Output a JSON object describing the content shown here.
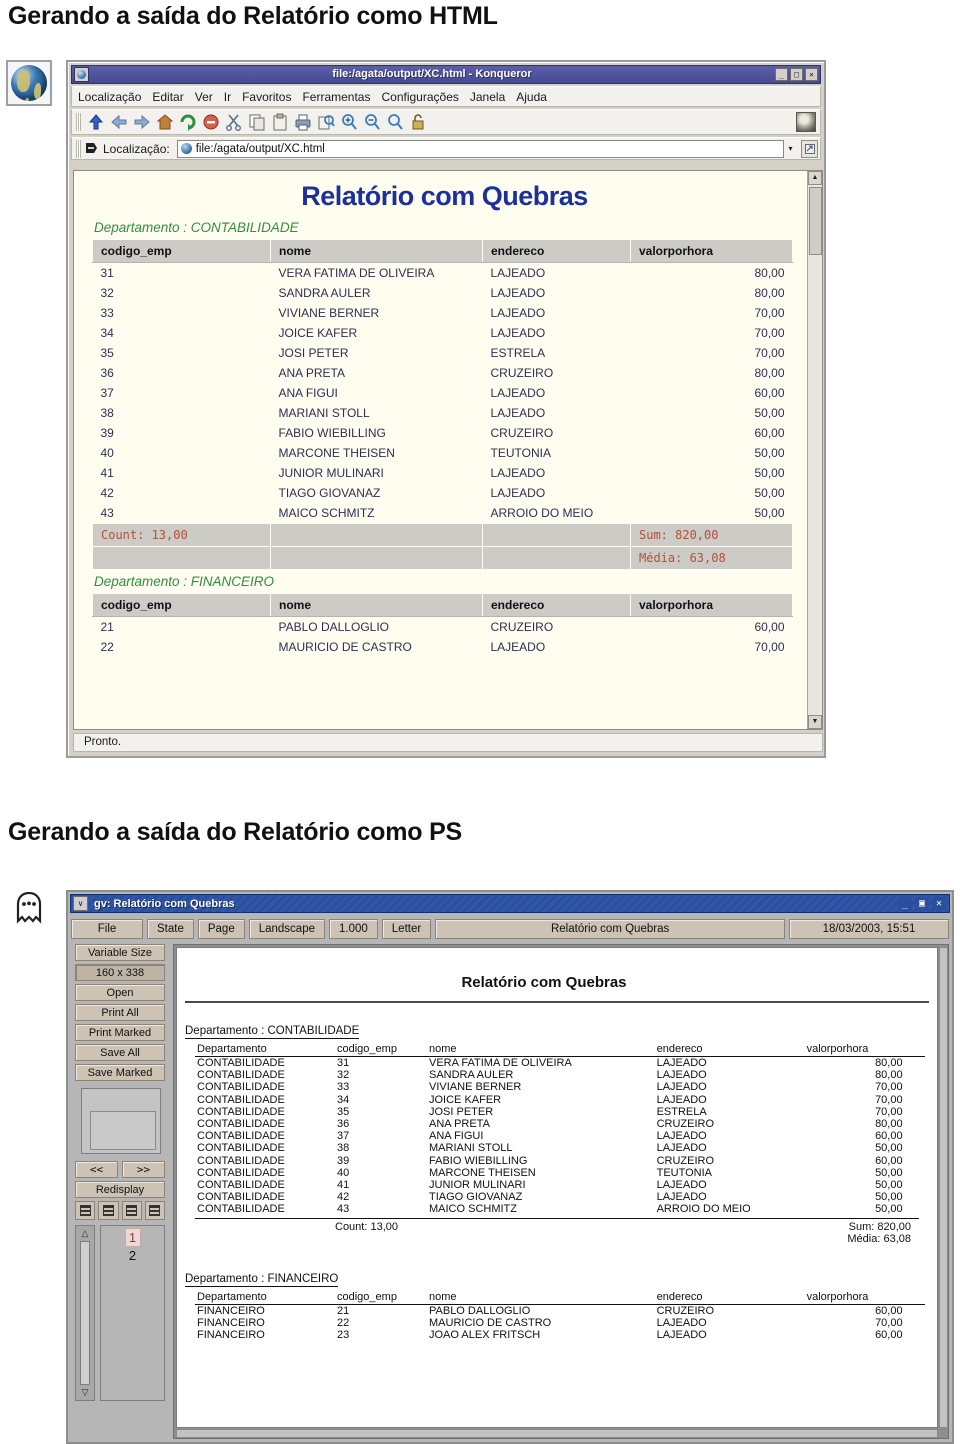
{
  "slides": {
    "html_heading": "Gerando a saída do Relatório como HTML",
    "ps_heading": "Gerando a saída do Relatório como PS"
  },
  "icons": {
    "globe": "globe-icon",
    "ghost": "ghost-icon"
  },
  "konqueror": {
    "title": "file:/agata/output/XC.html - Konqueror",
    "window_buttons": {
      "minimize": "_",
      "maximize": "□",
      "close": "✕"
    },
    "menu": [
      {
        "label": "Localização"
      },
      {
        "label": "Editar"
      },
      {
        "label": "Ver"
      },
      {
        "label": "Ir"
      },
      {
        "label": "Favoritos"
      },
      {
        "label": "Ferramentas"
      },
      {
        "label": "Configurações"
      },
      {
        "label": "Janela"
      },
      {
        "label": "Ajuda"
      }
    ],
    "toolbar_icons": [
      "up-arrow-icon",
      "back-arrow-icon",
      "forward-arrow-icon",
      "home-icon",
      "reload-icon",
      "stop-icon",
      "cut-scissors-icon",
      "copy-icon",
      "paste-icon",
      "print-icon",
      "find-icon",
      "zoom-in-icon",
      "zoom-out-icon",
      "zoom-reset-icon",
      "lock-icon"
    ],
    "location": {
      "label": "Localização:",
      "value": "file:/agata/output/XC.html",
      "placeholder": "file:/"
    },
    "statusbar": "Pronto."
  },
  "report": {
    "title": "Relatório com Quebras",
    "columns": [
      "codigo_emp",
      "nome",
      "endereco",
      "valorporhora"
    ],
    "groups": [
      {
        "label": "Departamento : CONTABILIDADE",
        "dept": "CONTABILIDADE",
        "rows": [
          {
            "codigo_emp": "31",
            "nome": "VERA FATIMA DE OLIVEIRA",
            "endereco": "LAJEADO",
            "valorporhora": "80,00"
          },
          {
            "codigo_emp": "32",
            "nome": "SANDRA AULER",
            "endereco": "LAJEADO",
            "valorporhora": "80,00"
          },
          {
            "codigo_emp": "33",
            "nome": "VIVIANE BERNER",
            "endereco": "LAJEADO",
            "valorporhora": "70,00"
          },
          {
            "codigo_emp": "34",
            "nome": "JOICE KAFER",
            "endereco": "LAJEADO",
            "valorporhora": "70,00"
          },
          {
            "codigo_emp": "35",
            "nome": "JOSI PETER",
            "endereco": "ESTRELA",
            "valorporhora": "70,00"
          },
          {
            "codigo_emp": "36",
            "nome": "ANA PRETA",
            "endereco": "CRUZEIRO",
            "valorporhora": "80,00"
          },
          {
            "codigo_emp": "37",
            "nome": "ANA FIGUI",
            "endereco": "LAJEADO",
            "valorporhora": "60,00"
          },
          {
            "codigo_emp": "38",
            "nome": "MARIANI STOLL",
            "endereco": "LAJEADO",
            "valorporhora": "50,00"
          },
          {
            "codigo_emp": "39",
            "nome": "FABIO WIEBILLING",
            "endereco": "CRUZEIRO",
            "valorporhora": "60,00"
          },
          {
            "codigo_emp": "40",
            "nome": "MARCONE THEISEN",
            "endereco": "TEUTONIA",
            "valorporhora": "50,00"
          },
          {
            "codigo_emp": "41",
            "nome": "JUNIOR MULINARI",
            "endereco": "LAJEADO",
            "valorporhora": "50,00"
          },
          {
            "codigo_emp": "42",
            "nome": "TIAGO GIOVANAZ",
            "endereco": "LAJEADO",
            "valorporhora": "50,00"
          },
          {
            "codigo_emp": "43",
            "nome": "MAICO SCHMITZ",
            "endereco": "ARROIO DO MEIO",
            "valorporhora": "50,00"
          }
        ],
        "summary": {
          "count": "Count: 13,00",
          "sum": "Sum: 820,00",
          "media": "Média: 63,08"
        }
      },
      {
        "label": "Departamento : FINANCEIRO",
        "dept": "FINANCEIRO",
        "rows": [
          {
            "codigo_emp": "21",
            "nome": "PABLO DALLOGLIO",
            "endereco": "CRUZEIRO",
            "valorporhora": "60,00"
          },
          {
            "codigo_emp": "22",
            "nome": "MAURICIO DE CASTRO",
            "endereco": "LAJEADO",
            "valorporhora": "70,00"
          },
          {
            "codigo_emp": "23",
            "nome": "JOAO ALEX FRITSCH",
            "endereco": "LAJEADO",
            "valorporhora": "60,00"
          }
        ]
      }
    ]
  },
  "gv": {
    "title": "gv: Relatório com Quebras",
    "window_buttons": {
      "minimize": "_",
      "maximize": "▣",
      "close": "✕"
    },
    "menu_button": "∨",
    "toolbar": [
      {
        "label": "File",
        "name": "file-menu"
      },
      {
        "label": "State",
        "name": "state-menu"
      },
      {
        "label": "Page",
        "name": "page-menu"
      },
      {
        "label": "Landscape",
        "name": "orientation-menu"
      },
      {
        "label": "1.000",
        "name": "scale-menu"
      },
      {
        "label": "Letter",
        "name": "papersize-menu"
      }
    ],
    "document_label": "Relatório com Quebras",
    "date_label": "18/03/2003, 15:51",
    "sidebar": [
      {
        "label": "Variable Size",
        "name": "variable-size-button",
        "pressed": false
      },
      {
        "label": "160 x 338",
        "name": "size-display",
        "pressed": true
      },
      {
        "label": "Open",
        "name": "open-button",
        "pressed": false
      },
      {
        "label": "Print All",
        "name": "print-all-button",
        "pressed": false
      },
      {
        "label": "Print Marked",
        "name": "print-marked-button",
        "pressed": false
      },
      {
        "label": "Save All",
        "name": "save-all-button",
        "pressed": false
      },
      {
        "label": "Save Marked",
        "name": "save-marked-button",
        "pressed": false
      }
    ],
    "nav": {
      "prev": "<<",
      "next": ">>",
      "redisplay": "Redisplay"
    },
    "pages": [
      {
        "number": "1",
        "current": true
      },
      {
        "number": "2",
        "current": false
      }
    ]
  },
  "ps_page": {
    "title": "Relatório com Quebras",
    "columns": [
      "Departamento",
      "codigo_emp",
      "nome",
      "endereco",
      "valorporhora"
    ]
  },
  "colors": {
    "report_title": "#1b2fa0",
    "dept_green": "#2f8f3f",
    "summary_red": "#b4503c",
    "konq_titlebar": "#464a91",
    "gv_titlebar": "#2b4f9e",
    "report_bg": "#fffdf0",
    "table_header_bg": "#cccbc6"
  }
}
